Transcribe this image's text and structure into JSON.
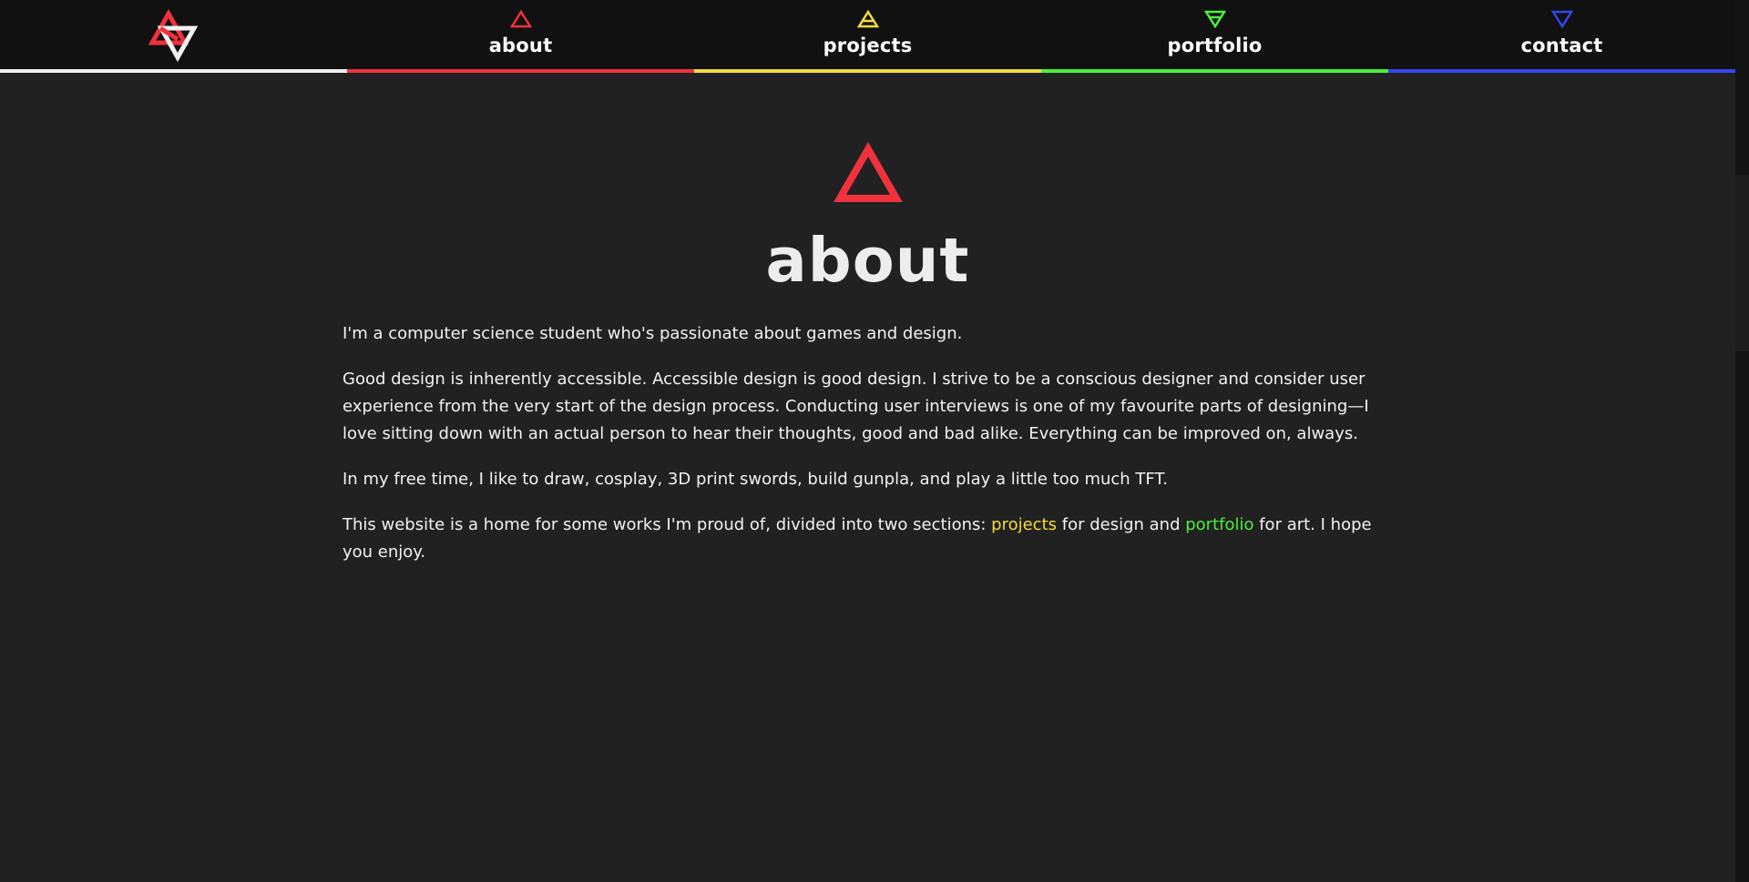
{
  "colors": {
    "background": "#212121",
    "nav_background": "#111111",
    "home": "#f2f2f2",
    "about": "#f0323c",
    "projects": "#f4dc3c",
    "portfolio": "#4cf03a",
    "contact": "#3246f0"
  },
  "nav": {
    "home": {
      "icon": "triangle-star-logo-icon"
    },
    "items": [
      {
        "label": "about",
        "icon": "triangle-up-icon"
      },
      {
        "label": "projects",
        "icon": "triangle-up-bar-icon"
      },
      {
        "label": "portfolio",
        "icon": "triangle-down-bar-icon"
      },
      {
        "label": "contact",
        "icon": "triangle-down-icon"
      }
    ]
  },
  "main": {
    "icon": "triangle-up-icon",
    "title": "about",
    "paragraphs": {
      "p1": "I'm a computer science student who's passionate about games and design.",
      "p2": "Good design is inherently accessible. Accessible design is good design. I strive to be a conscious designer and consider user experience from the very start of the design process. Conducting user interviews is one of my favourite parts of designing—I love sitting down with an actual person to hear their thoughts, good and bad alike. Everything can be improved on, always.",
      "p3": "In my free time, I like to draw, cosplay, 3D print swords, build gunpla, and play a little too much TFT.",
      "p4_before": "This website is a home for some works I'm proud of, divided into two sections: ",
      "p4_projects_link": "projects",
      "p4_middle": " for design and ",
      "p4_portfolio_link": "portfolio",
      "p4_after": " for art. I hope you enjoy."
    }
  }
}
